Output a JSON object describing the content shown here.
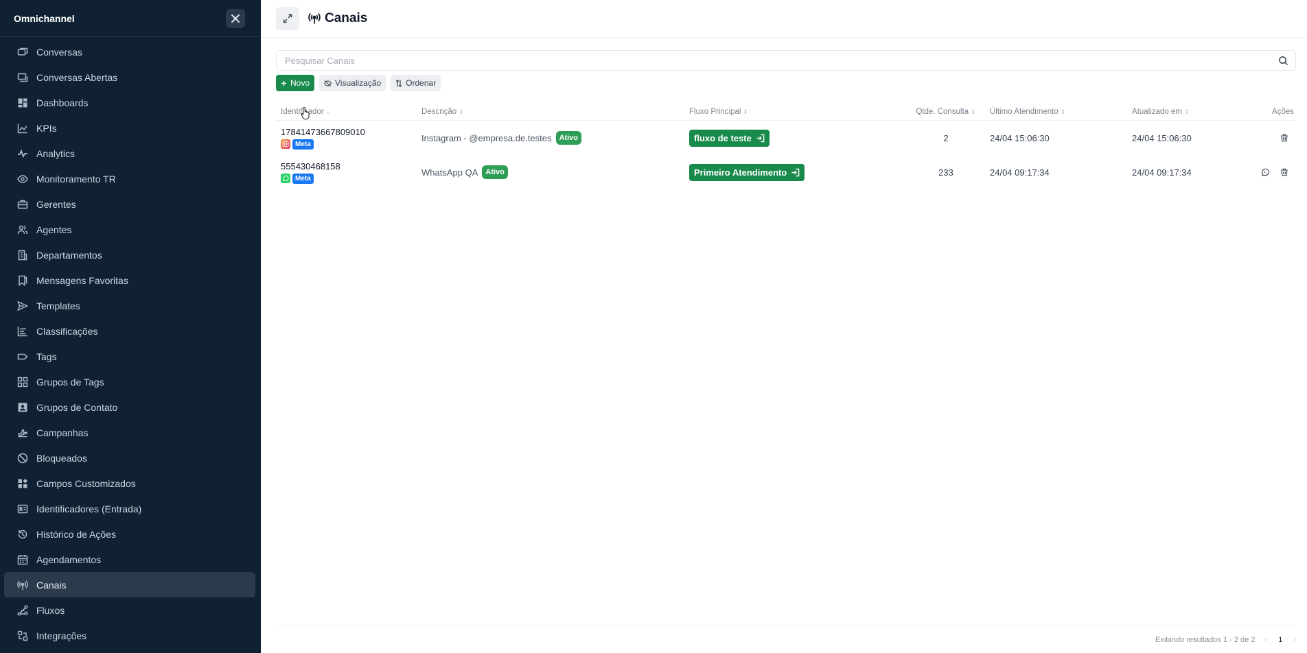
{
  "sidebar": {
    "title": "Omnichannel",
    "items": [
      {
        "label": "Conversas",
        "icon": "chat-icon"
      },
      {
        "label": "Conversas Abertas",
        "icon": "open-chats-icon"
      },
      {
        "label": "Dashboards",
        "icon": "dashboard-icon"
      },
      {
        "label": "KPIs",
        "icon": "chart-line-icon"
      },
      {
        "label": "Analytics",
        "icon": "pulse-icon"
      },
      {
        "label": "Monitoramento TR",
        "icon": "eye-icon"
      },
      {
        "label": "Gerentes",
        "icon": "briefcase-icon"
      },
      {
        "label": "Agentes",
        "icon": "users-icon"
      },
      {
        "label": "Departamentos",
        "icon": "building-icon"
      },
      {
        "label": "Mensagens Favoritas",
        "icon": "bookmark-icon"
      },
      {
        "label": "Templates",
        "icon": "send-icon"
      },
      {
        "label": "Classificações",
        "icon": "list-icon"
      },
      {
        "label": "Tags",
        "icon": "tag-icon"
      },
      {
        "label": "Grupos de Tags",
        "icon": "grid-icon"
      },
      {
        "label": "Grupos de Contato",
        "icon": "contact-icon"
      },
      {
        "label": "Campanhas",
        "icon": "plane-icon"
      },
      {
        "label": "Bloqueados",
        "icon": "ban-icon"
      },
      {
        "label": "Campos Customizados",
        "icon": "widgets-icon"
      },
      {
        "label": "Identificadores (Entrada)",
        "icon": "id-card-icon"
      },
      {
        "label": "Histórico de Ações",
        "icon": "history-icon"
      },
      {
        "label": "Agendamentos",
        "icon": "calendar-icon"
      },
      {
        "label": "Canais",
        "icon": "antenna-icon",
        "active": true
      },
      {
        "label": "Fluxos",
        "icon": "flow-icon"
      },
      {
        "label": "Integrações",
        "icon": "integration-icon"
      }
    ]
  },
  "header": {
    "title": "Canais"
  },
  "search": {
    "placeholder": "Pesquisar Canais"
  },
  "toolbar": {
    "new_label": "Novo",
    "view_label": "Visualização",
    "sort_label": "Ordenar"
  },
  "table": {
    "columns": [
      "Identificador",
      "Descrição",
      "Fluxo Principal",
      "Qtde. Consulta",
      "Último Atendimento",
      "Atualizado em",
      "Ações"
    ],
    "rows": [
      {
        "identifier": "17841473667809010",
        "channel": "instagram",
        "provider": "Meta",
        "description": "Instagram - @empresa.de.testes",
        "status": "Ativo",
        "flow": "fluxo de teste",
        "count": "2",
        "last_service": "24/04 15:06:30",
        "updated": "24/04 15:06:30"
      },
      {
        "identifier": "555430468158",
        "channel": "whatsapp",
        "provider": "Meta",
        "description": "WhatsApp QA",
        "status": "Ativo",
        "flow": "Primeiro Atendimento",
        "count": "233",
        "last_service": "24/04 09:17:34",
        "updated": "24/04 09:17:34"
      }
    ]
  },
  "footer": {
    "results": "Exibindo resultados 1 - 2 de 2",
    "page": "1"
  },
  "colors": {
    "sidebar_bg": "#0f2133",
    "primary": "#188a4b",
    "meta": "#1877f2"
  }
}
